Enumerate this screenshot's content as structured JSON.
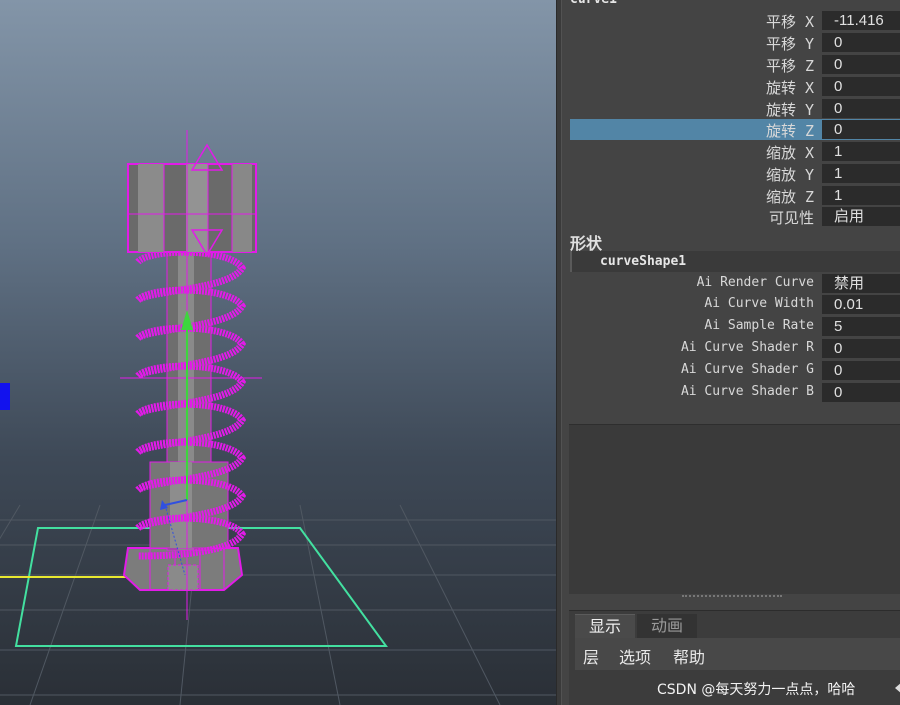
{
  "object": {
    "name": "curve1"
  },
  "transform_attrs": [
    {
      "label": "平移 X",
      "value": "-11.416"
    },
    {
      "label": "平移 Y",
      "value": "0"
    },
    {
      "label": "平移 Z",
      "value": "0"
    },
    {
      "label": "旋转 X",
      "value": "0"
    },
    {
      "label": "旋转 Y",
      "value": "0"
    },
    {
      "label": "旋转 Z",
      "value": "0"
    },
    {
      "label": "缩放 X",
      "value": "1"
    },
    {
      "label": "缩放 Y",
      "value": "1"
    },
    {
      "label": "缩放 Z",
      "value": "1"
    },
    {
      "label": "可见性",
      "value": "启用"
    }
  ],
  "selected_attr": "旋转 Z",
  "shapes": {
    "title": "形状",
    "name": "curveShape1"
  },
  "shape_attrs": [
    {
      "label": "Ai Render Curve",
      "value": "禁用"
    },
    {
      "label": "Ai Curve Width",
      "value": "0.01"
    },
    {
      "label": "Ai Sample Rate",
      "value": "5"
    },
    {
      "label": "Ai Curve Shader R",
      "value": "0"
    },
    {
      "label": "Ai Curve Shader G",
      "value": "0"
    },
    {
      "label": "Ai Curve Shader B",
      "value": "0"
    }
  ],
  "layer_editor": {
    "tabs": [
      "显示",
      "动画"
    ],
    "active_tab": "显示",
    "menu": [
      "层",
      "选项",
      "帮助"
    ]
  },
  "watermark": "CSDN @每天努力一点点，哈哈",
  "colors": {
    "selection": "#5285a6",
    "wireframe_highlight": "#e21be8",
    "manipulator_y": "#3dd63d",
    "grid_highlight": "#43e0a0"
  }
}
